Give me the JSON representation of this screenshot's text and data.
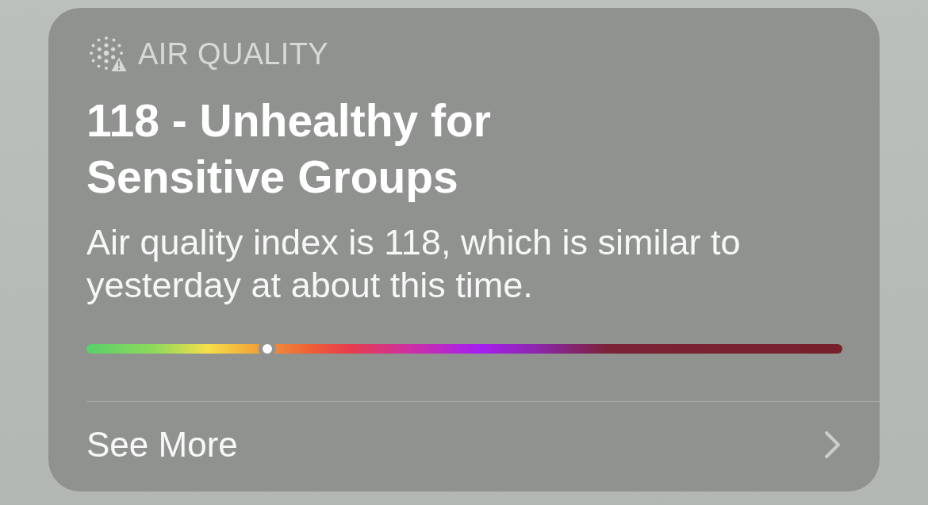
{
  "card": {
    "header": {
      "title": "AIR QUALITY"
    },
    "heading": "118 - Unhealthy for Sensitive Groups",
    "description": "Air quality index is 118, which is similar to yesterday at about this time.",
    "scale": {
      "level": 0.239
    },
    "footer": {
      "link": "See More"
    }
  }
}
